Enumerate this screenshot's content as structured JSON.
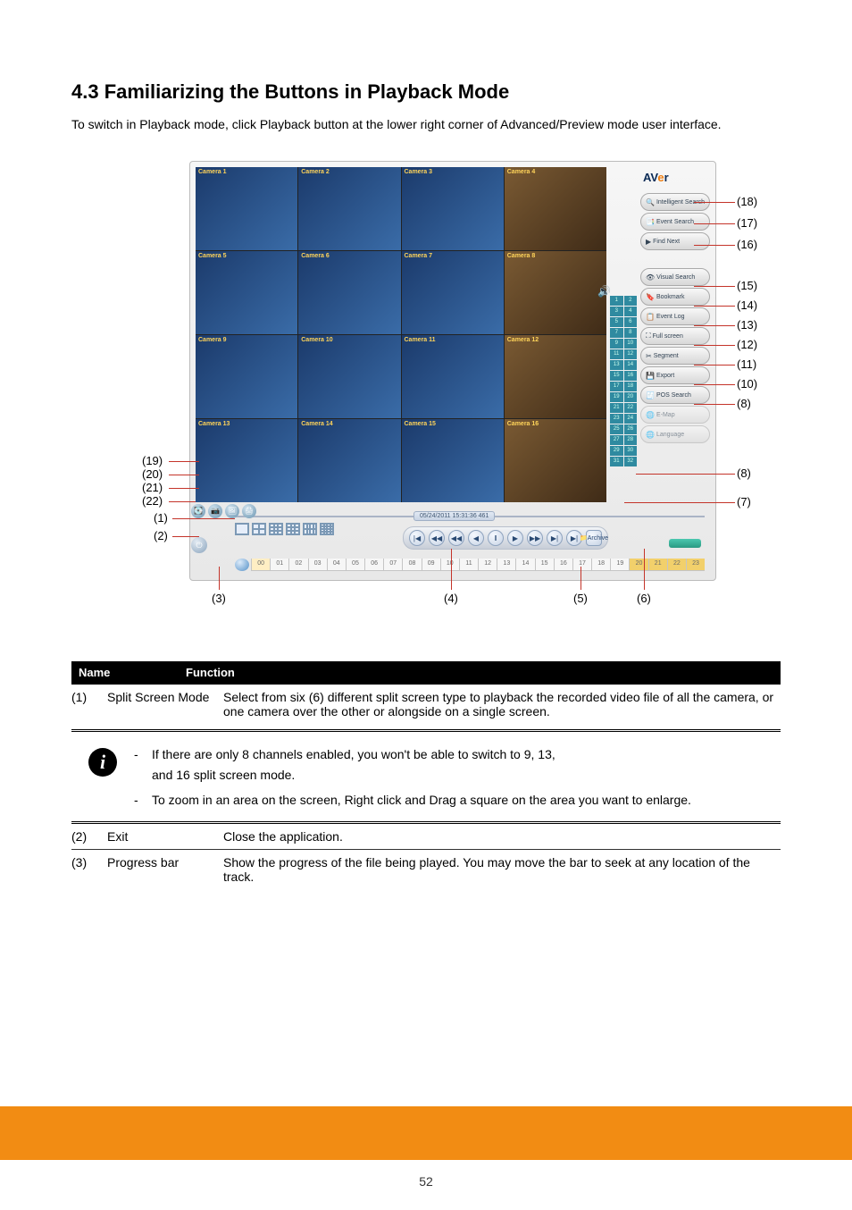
{
  "heading": "4.3 Familiarizing the Buttons in Playback Mode",
  "intro": "To switch in Playback mode, click Playback button at the lower right corner of Advanced/Preview mode user interface.",
  "screenshot": {
    "logo_text": "AVer",
    "cameras": [
      "Camera 1",
      "Camera 2",
      "Camera 3",
      "Camera 4",
      "Camera 5",
      "Camera 6",
      "Camera 7",
      "Camera 8",
      "Camera 9",
      "Camera 10",
      "Camera 11",
      "Camera 12",
      "Camera 13",
      "Camera 14",
      "Camera 15",
      "Camera 16"
    ],
    "menu_items": [
      {
        "label": "Intelligent Search"
      },
      {
        "label": "Event Search"
      },
      {
        "label": "Find Next"
      },
      {
        "label": "Visual Search"
      },
      {
        "label": "Bookmark"
      },
      {
        "label": "Event Log"
      },
      {
        "label": "Full screen"
      },
      {
        "label": "Segment"
      },
      {
        "label": "Export"
      },
      {
        "label": "POS Search"
      },
      {
        "label": "E-Map"
      },
      {
        "label": "Language"
      }
    ],
    "channel_strip": [
      "1",
      "2",
      "3",
      "4",
      "5",
      "6",
      "7",
      "8",
      "9",
      "10",
      "11",
      "12",
      "13",
      "14",
      "15",
      "16",
      "17",
      "18",
      "19",
      "20",
      "21",
      "22",
      "23",
      "24",
      "25",
      "26",
      "27",
      "28",
      "29",
      "30",
      "31",
      "32"
    ],
    "playback_date": "05/24/2011 15:31:36 461",
    "playback_controls": [
      "|◀",
      "◀◀",
      "◀◀",
      "◀",
      "‖",
      "▶",
      "▶▶",
      "▶|",
      "▶|"
    ],
    "archive_label": "Archive",
    "hours": [
      "00",
      "01",
      "02",
      "03",
      "04",
      "05",
      "06",
      "07",
      "08",
      "09",
      "10",
      "11",
      "12",
      "13",
      "14",
      "15",
      "16",
      "17",
      "18",
      "19",
      "20",
      "21",
      "22",
      "23"
    ]
  },
  "callouts": {
    "18": "(18)",
    "17": "(17)",
    "16": "(16)",
    "15": "(15)",
    "14": "(14)",
    "13": "(13)",
    "12": "(12)",
    "11": "(11)",
    "10": "(10)",
    "8a": "(8)",
    "8b": "(8)",
    "7": "(7)",
    "19": "(19)",
    "20": "(20)",
    "21": "(21)",
    "22": "(22)",
    "1": "(1)",
    "2": "(2)",
    "3": "(3)",
    "4": "(4)",
    "5": "(5)",
    "6": "(6)"
  },
  "table_header": {
    "name": "Name",
    "function": "Function"
  },
  "row1": {
    "num": "(1)",
    "name": "Split Screen Mode",
    "func": "Select from six (6) different split screen type to playback the recorded video file of all the camera, or one camera over the other or alongside on a single screen."
  },
  "note": {
    "line1_a": "If there are only 8 channels enabled",
    "line1_b": ", you won't be able to switch to 9, 13,",
    "line2": "and 16 split screen mode.",
    "line3": "To zoom in an area on the screen, Right click and Drag a square on the area you want to enlarge."
  },
  "row2": {
    "num": "(2)",
    "name": "Exit",
    "func": "Close the application."
  },
  "row3": {
    "num": "(3)",
    "name": "Progress bar",
    "func": "Show the progress of the file being played. You may move the bar to seek at any location of the track."
  },
  "page_number": "52"
}
